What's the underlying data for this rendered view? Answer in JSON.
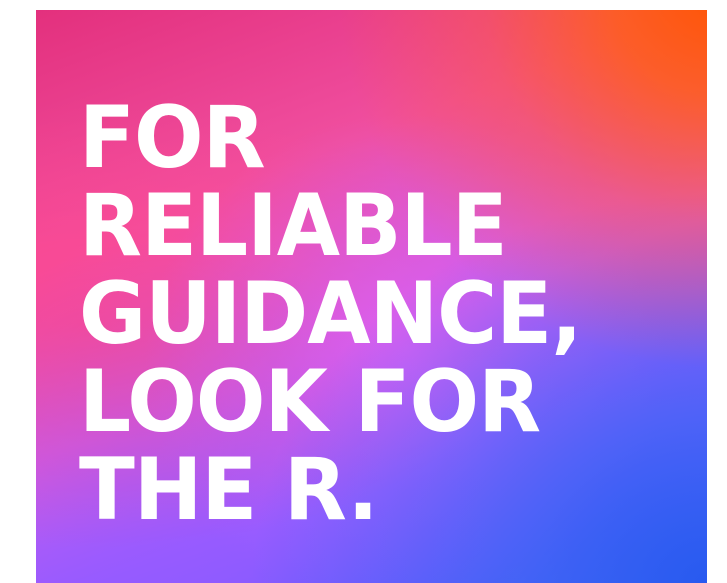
{
  "ad": {
    "headline_lines": [
      "FOR",
      "RELIABLE",
      "GUIDANCE,",
      "LOOK FOR",
      "THE R."
    ]
  },
  "colors": {
    "gradient_top_left": "#e3307d",
    "gradient_top_right": "#ff5500",
    "gradient_middle": "#d95ce8",
    "gradient_bottom_right": "#3f66f0",
    "gradient_bottom_left": "#9a5cff",
    "text": "#ffffff"
  }
}
